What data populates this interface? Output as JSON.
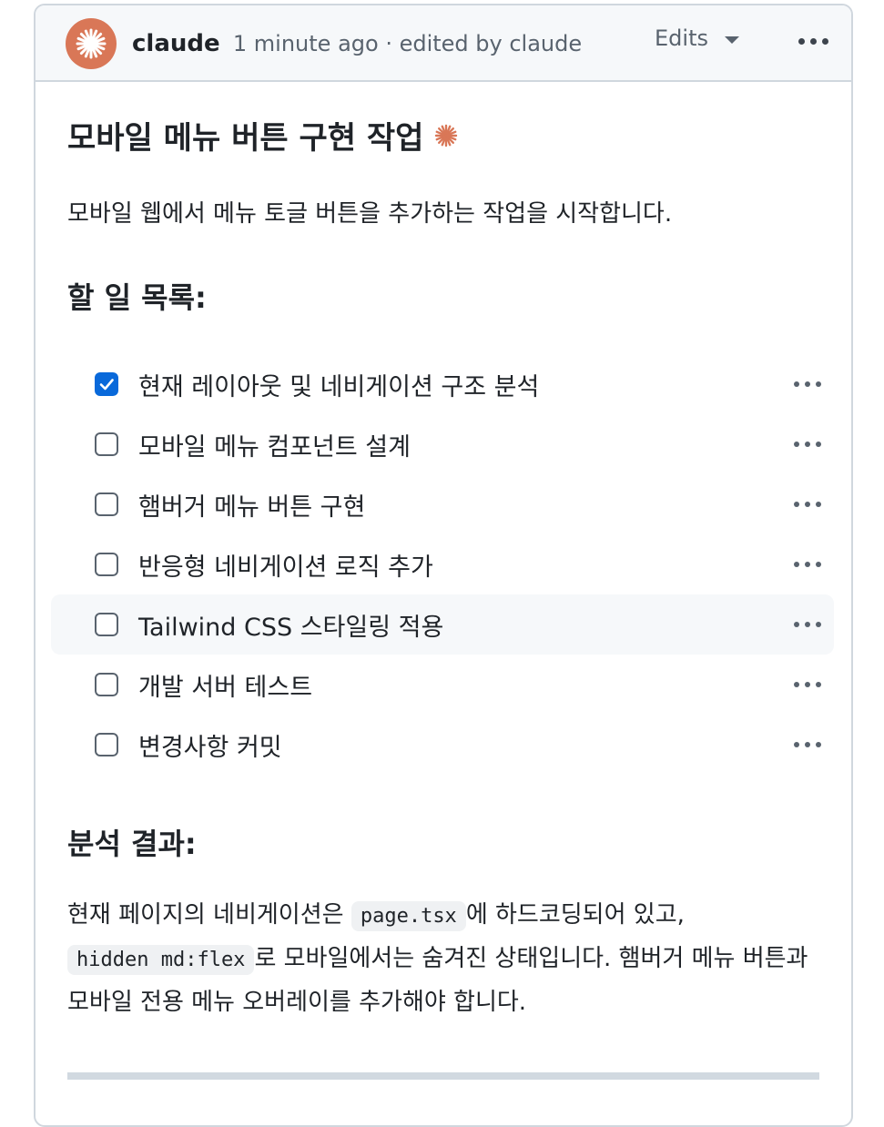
{
  "header": {
    "author": "claude",
    "meta": "1 minute ago · edited by claude",
    "edits_label": "Edits"
  },
  "content": {
    "title": "모바일 메뉴 버튼 구현 작업",
    "intro": "모바일 웹에서 메뉴 토글 버튼을 추가하는 작업을 시작합니다.",
    "todo_heading": "할 일 목록:",
    "todos": [
      {
        "label": "현재 레이아웃 및 네비게이션 구조 분석",
        "checked": true
      },
      {
        "label": "모바일 메뉴 컴포넌트 설계",
        "checked": false
      },
      {
        "label": "햄버거 메뉴 버튼 구현",
        "checked": false
      },
      {
        "label": "반응형 네비게이션 로직 추가",
        "checked": false
      },
      {
        "label": "Tailwind CSS 스타일링 적용",
        "checked": false
      },
      {
        "label": "개발 서버 테스트",
        "checked": false
      },
      {
        "label": "변경사항 커밋",
        "checked": false
      }
    ],
    "analysis_heading": "분석 결과:",
    "analysis": {
      "part1": "현재 페이지의 네비게이션은 ",
      "code1": "page.tsx",
      "part2": "에 하드코딩되어 있고,",
      "code2": "hidden md:flex",
      "part3": "로 모바일에서는 숨겨진 상태입니다. 햄버거 메뉴 버튼과 모바일 전용 메뉴 오버레이를 추가해야 합니다."
    }
  },
  "colors": {
    "accent": "#d97757",
    "checkbox_checked": "#0969da",
    "header_bg": "#f6f8fa",
    "border": "#d0d7de"
  },
  "icons": {
    "avatar": "claude-spark-icon",
    "title_badge": "claude-spark-icon",
    "menu": "kebab-horizontal-icon",
    "dropdown": "triangle-down-icon",
    "check": "check-icon"
  }
}
